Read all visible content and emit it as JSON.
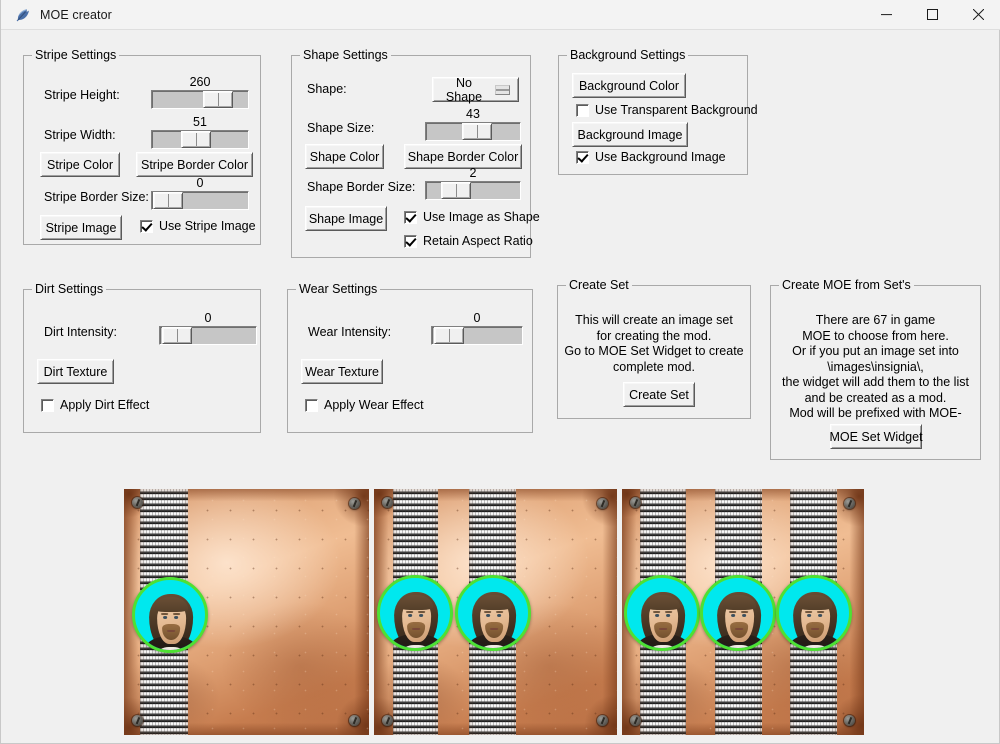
{
  "window": {
    "title": "MOE creator",
    "icon": "feather-icon",
    "controls": {
      "minimize": "minimize-icon",
      "maximize": "maximize-icon",
      "close": "close-icon"
    },
    "background_color": "#f0f0f0"
  },
  "stripe_settings": {
    "title": "Stripe Settings",
    "height_label": "Stripe Height:",
    "height_value": "260",
    "height_fill_pct": 78,
    "width_label": "Stripe Width:",
    "width_value": "51",
    "width_fill_pct": 44,
    "border_size_label": "Stripe Border Size:",
    "border_size_value": "0",
    "border_size_fill_pct": 2,
    "color_button": "Stripe Color",
    "border_color_button": "Stripe Border Color",
    "image_button": "Stripe Image",
    "use_image_label": "Use Stripe Image",
    "use_image_checked": true
  },
  "shape_settings": {
    "title": "Shape Settings",
    "shape_label": "Shape:",
    "shape_value": "No Shape",
    "shape_options": [
      "No Shape"
    ],
    "size_label": "Shape Size:",
    "size_value": "43",
    "size_fill_pct": 56,
    "color_button": "Shape Color",
    "border_color_button": "Shape Border Color",
    "border_size_label": "Shape Border Size:",
    "border_size_value": "2",
    "border_size_fill_pct": 24,
    "image_button": "Shape Image",
    "use_image_as_shape_label": "Use Image as Shape",
    "use_image_as_shape_checked": true,
    "retain_aspect_label": "Retain Aspect Ratio",
    "retain_aspect_checked": true
  },
  "background_settings": {
    "title": "Background Settings",
    "color_button": "Background Color",
    "transparent_label": "Use Transparent Background",
    "transparent_checked": false,
    "image_button": "Background Image",
    "use_image_label": "Use Background Image",
    "use_image_checked": true
  },
  "dirt_settings": {
    "title": "Dirt Settings",
    "intensity_label": "Dirt Intensity:",
    "intensity_value": "0",
    "intensity_fill_pct": 3,
    "texture_button": "Dirt Texture",
    "apply_label": "Apply Dirt Effect",
    "apply_checked": false
  },
  "wear_settings": {
    "title": "Wear Settings",
    "intensity_label": "Wear Intensity:",
    "intensity_value": "0",
    "intensity_fill_pct": 3,
    "texture_button": "Wear Texture",
    "apply_label": "Apply Wear Effect",
    "apply_checked": false
  },
  "create_set": {
    "title": "Create Set",
    "description": "This will create an image set\nfor creating the mod.\nGo to MOE Set Widget to create\ncomplete mod.",
    "button": "Create Set"
  },
  "create_moe": {
    "title": "Create MOE from Set's",
    "description": "There are 67 in game\nMOE to choose from here.\nOr if you put an image set into\n\\images\\insignia\\,\nthe widget will add them to the list\nand be created as a mod.\nMod will be prefixed with MOE-",
    "button": "MOE Set Widget"
  },
  "previews": {
    "badge_fill_color": "#00e8ee",
    "badge_border_color": "#4ee033",
    "plate_color": "#d59367",
    "items": [
      {
        "name": "preview-one-stripe",
        "stripe_count": 1
      },
      {
        "name": "preview-two-stripes",
        "stripe_count": 2
      },
      {
        "name": "preview-three-stripes",
        "stripe_count": 3
      }
    ]
  }
}
